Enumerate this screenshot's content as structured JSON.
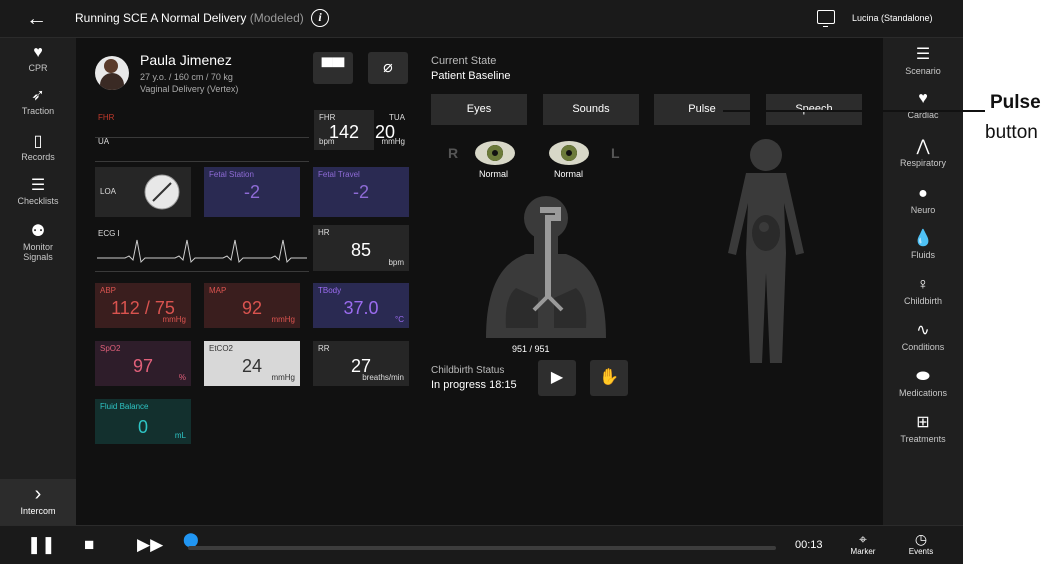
{
  "topbar": {
    "title_main": "Running SCE  A Normal Delivery",
    "title_muted": " (Modeled)",
    "user": "Lucina (Standalone)"
  },
  "left_nav": [
    {
      "label": "CPR",
      "icon": "heart-pulse-icon"
    },
    {
      "label": "Traction",
      "icon": "traction-icon"
    },
    {
      "label": "Records",
      "icon": "clipboard-icon"
    },
    {
      "label": "Checklists",
      "icon": "checklist-icon"
    },
    {
      "label": "Monitor Signals",
      "icon": "monitor-signals-icon"
    }
  ],
  "intercom": {
    "label": "Intercom",
    "icon": "chevron-right-icon"
  },
  "right_nav": [
    {
      "label": "Scenario",
      "icon": "list-icon"
    },
    {
      "label": "Cardiac",
      "icon": "heart-icon"
    },
    {
      "label": "Respiratory",
      "icon": "lungs-icon"
    },
    {
      "label": "Neuro",
      "icon": "brain-icon"
    },
    {
      "label": "Fluids",
      "icon": "drop-icon"
    },
    {
      "label": "Childbirth",
      "icon": "childbirth-icon"
    },
    {
      "label": "Conditions",
      "icon": "pulse-wave-icon"
    },
    {
      "label": "Medications",
      "icon": "pill-icon"
    },
    {
      "label": "Treatments",
      "icon": "medkit-icon"
    }
  ],
  "patient": {
    "name": "Paula Jimenez",
    "details": "27 y.o. / 160 cm / 70 kg",
    "delivery": "Vaginal Delivery (Vertex)"
  },
  "waves": {
    "fhr": "FHR",
    "ua": "UA",
    "ecg": "ECG I"
  },
  "vitals": {
    "fhr": {
      "label": "FHR",
      "value": "142",
      "unit": "bpm"
    },
    "tua": {
      "label": "TUA",
      "value": "20",
      "unit": "mmHg"
    },
    "loa": {
      "label": "LOA"
    },
    "fetal_station": {
      "label": "Fetal Station",
      "value": "-2"
    },
    "fetal_travel": {
      "label": "Fetal Travel",
      "value": "-2"
    },
    "hr": {
      "label": "HR",
      "value": "85",
      "unit": "bpm"
    },
    "abp": {
      "label": "ABP",
      "value": "112 / 75",
      "unit": "mmHg"
    },
    "map": {
      "label": "MAP",
      "value": "92",
      "unit": "mmHg"
    },
    "tbody": {
      "label": "TBody",
      "value": "37.0",
      "unit": "°C"
    },
    "spo2": {
      "label": "SpO2",
      "value": "97",
      "unit": "%"
    },
    "etco2": {
      "label": "EtCO2",
      "value": "24",
      "unit": "mmHg"
    },
    "rr": {
      "label": "RR",
      "value": "27",
      "unit": "breaths/min"
    },
    "fluid": {
      "label": "Fluid Balance",
      "value": "0",
      "unit": "mL"
    }
  },
  "state": {
    "label": "Current State",
    "value": "Patient Baseline"
  },
  "tabs": [
    "Eyes",
    "Sounds",
    "Pulse",
    "Speech"
  ],
  "eyes": {
    "r": "R",
    "l": "L",
    "right_status": "Normal",
    "left_status": "Normal"
  },
  "breath_count": "951 / 951",
  "childbirth": {
    "label": "Childbirth Status",
    "value": "In progress 18:15"
  },
  "bottom": {
    "time": "00:13",
    "marker": "Marker",
    "events": "Events"
  },
  "annotation": {
    "line1": "Pulse",
    "line2": "button"
  },
  "colors": {
    "fhr_red": "#c0392b",
    "ua_gray": "#dddddd",
    "fetal_purple": "#8e6bd6",
    "abp_red": "#d9534f",
    "tbody_purple": "#9b6cf0",
    "spo2_pink": "#e0607a",
    "fluid_teal": "#2ec4c4",
    "marker_blue": "#2196f3"
  }
}
